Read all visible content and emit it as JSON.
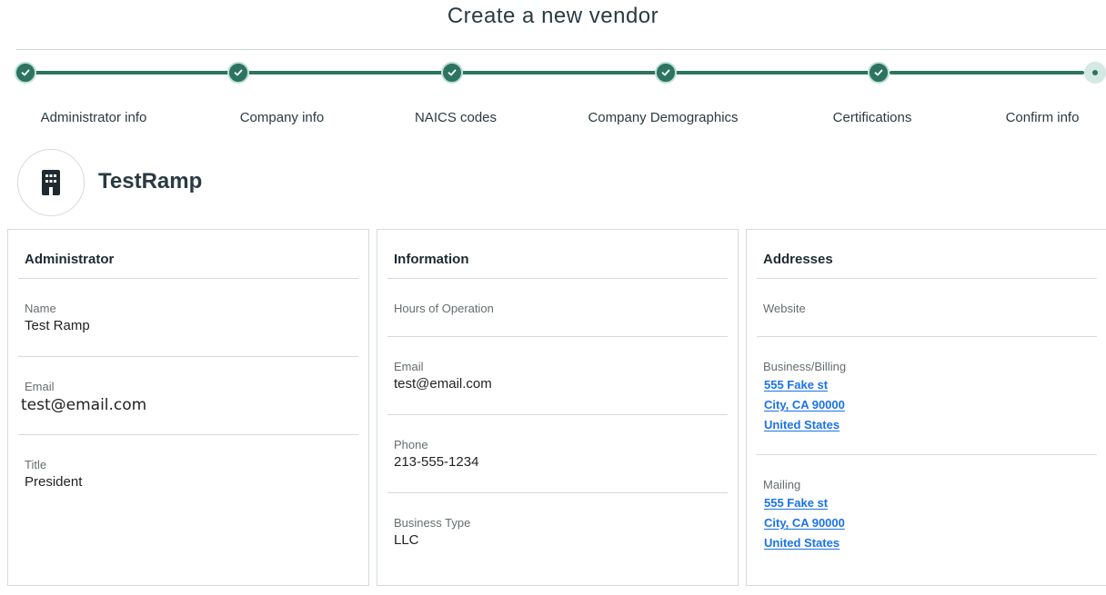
{
  "page": {
    "title": "Create a new vendor"
  },
  "stepper": {
    "steps": [
      {
        "label": "Administrator info",
        "state": "complete"
      },
      {
        "label": "Company info",
        "state": "complete"
      },
      {
        "label": "NAICS codes",
        "state": "complete"
      },
      {
        "label": "Company Demographics",
        "state": "complete"
      },
      {
        "label": "Certifications",
        "state": "complete"
      },
      {
        "label": "Confirm info",
        "state": "current"
      }
    ],
    "accent_color": "#2c7460"
  },
  "company": {
    "name": "TestRamp",
    "icon": "building-icon"
  },
  "administrator": {
    "title": "Administrator",
    "name_label": "Name",
    "name_value": "Test Ramp",
    "email_label": "Email",
    "email_value": "test@email.com",
    "title_label": "Title",
    "title_value": "President"
  },
  "information": {
    "title": "Information",
    "hours_label": "Hours of Operation",
    "hours_value": "",
    "email_label": "Email",
    "email_value": "test@email.com",
    "phone_label": "Phone",
    "phone_value": "213-555-1234",
    "business_type_label": "Business Type",
    "business_type_value": "LLC"
  },
  "addresses": {
    "title": "Addresses",
    "website_label": "Website",
    "website_value": "",
    "billing_label": "Business/Billing",
    "billing_lines": [
      "555 Fake st",
      "City, CA 90000",
      "United States"
    ],
    "mailing_label": "Mailing",
    "mailing_lines": [
      "555 Fake st",
      "City, CA 90000",
      "United States"
    ],
    "link_color": "#1a73e8"
  }
}
